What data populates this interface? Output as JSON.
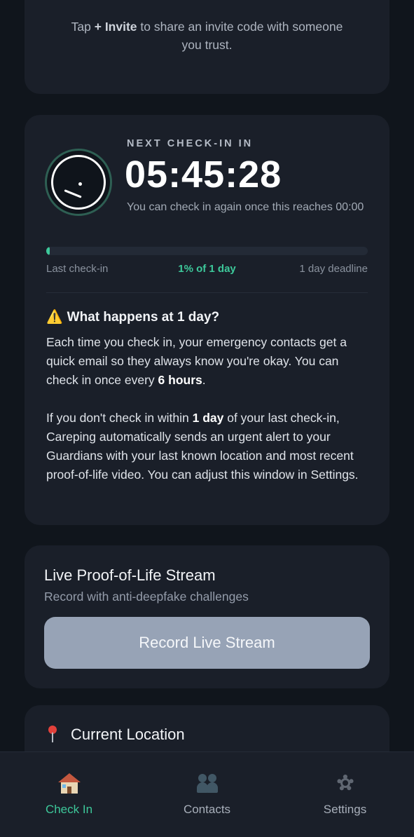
{
  "invite_card": {
    "title_partial": "…",
    "tip_prefix": "Tap ",
    "tip_bold": "+ Invite",
    "tip_suffix": " to share an invite code with someone you trust."
  },
  "timer_card": {
    "label": "NEXT CHECK-IN IN",
    "countdown": "05:45:28",
    "subtext": "You can check in again once this reaches 00:00",
    "progress_fraction": 0.01,
    "progress_left": "Last check-in",
    "progress_center": "1% of 1 day",
    "progress_right": "1 day deadline",
    "warning_icon": "⚠️",
    "warning_title": "What happens at 1 day?",
    "p1_a": "Each time you check in, your emergency contacts get a quick email so they always know you're okay. You can check in once every ",
    "p1_bold": "6 hours",
    "p1_b": ".",
    "p2_a": "If you don't check in within ",
    "p2_bold": "1 day",
    "p2_b": " of your last check-in, Careping automatically sends an urgent alert to your Guardians with your last known location and most recent proof-of-life video. You can adjust this window in Settings."
  },
  "stream_card": {
    "title": "Live Proof-of-Life Stream",
    "subtitle": "Record with anti-deepfake challenges",
    "button": "Record Live Stream"
  },
  "location_card": {
    "icon": "pin-icon",
    "title": "Current Location"
  },
  "nav": {
    "items": [
      {
        "label": "Check In",
        "icon": "house-icon",
        "active": true
      },
      {
        "label": "Contacts",
        "icon": "contacts-icon",
        "active": false
      },
      {
        "label": "Settings",
        "icon": "gear-icon",
        "active": false
      }
    ]
  },
  "colors": {
    "accent": "#3dc89a",
    "background": "#10151c",
    "card": "#1a1f29",
    "button": "#97a3b6"
  }
}
